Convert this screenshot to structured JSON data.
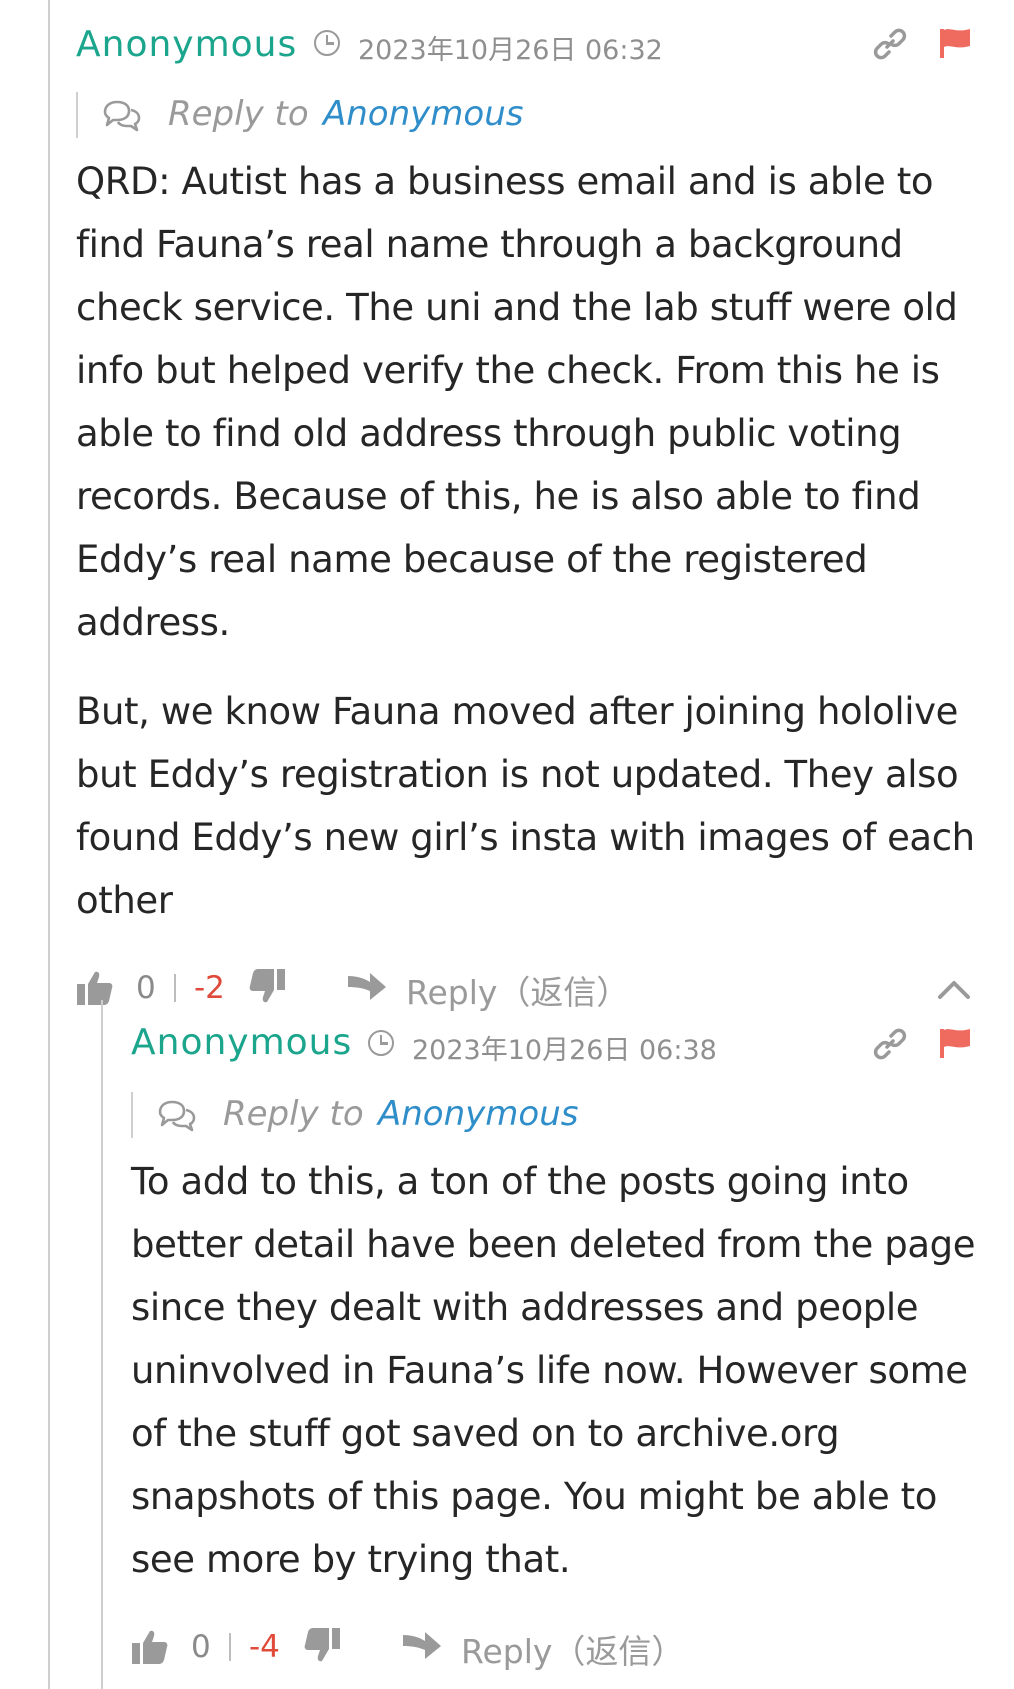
{
  "comments": [
    {
      "author": "Anonymous",
      "timestamp": "2023年10月26日 06:32",
      "reply_to_label": "Reply to",
      "reply_to_target": "Anonymous",
      "paragraphs": [
        "QRD: Autist has a business email and is able to find Fauna’s real name through a background check service. The uni and the lab stuff were old info but helped verify the check. From this he is able to find old address through public voting records. Because of this, he is also able to find Eddy’s real name because of the registered address.",
        "But, we know Fauna moved after joining hololive but Eddy’s registration is not updated. They also found Eddy’s new girl’s insta with images of each other"
      ],
      "upvotes": "0",
      "downvotes": "-2",
      "reply_label": "Reply（返信）"
    },
    {
      "author": "Anonymous",
      "timestamp": "2023年10月26日 06:38",
      "reply_to_label": "Reply to",
      "reply_to_target": "Anonymous",
      "paragraphs": [
        "To add to this, a ton of the posts going into better detail have been deleted from the page since they dealt with addresses and people uninvolved in Fauna’s life now. However some of the stuff got saved on to archive.org snapshots of this page. You might be able to see more by trying that."
      ],
      "upvotes": "0",
      "downvotes": "-4",
      "reply_label": "Reply（返信）"
    }
  ],
  "colors": {
    "author": "#1ba58d",
    "reply_target": "#2f8ec9",
    "downvote": "#e04a3a",
    "flag": "#ef6a5f",
    "muted": "#9a9a9a"
  },
  "icons": [
    "clock-icon",
    "link-icon",
    "flag-icon",
    "chat-bubbles-icon",
    "thumbs-up-icon",
    "thumbs-down-icon",
    "reply-arrow-icon",
    "chevron-up-icon"
  ]
}
